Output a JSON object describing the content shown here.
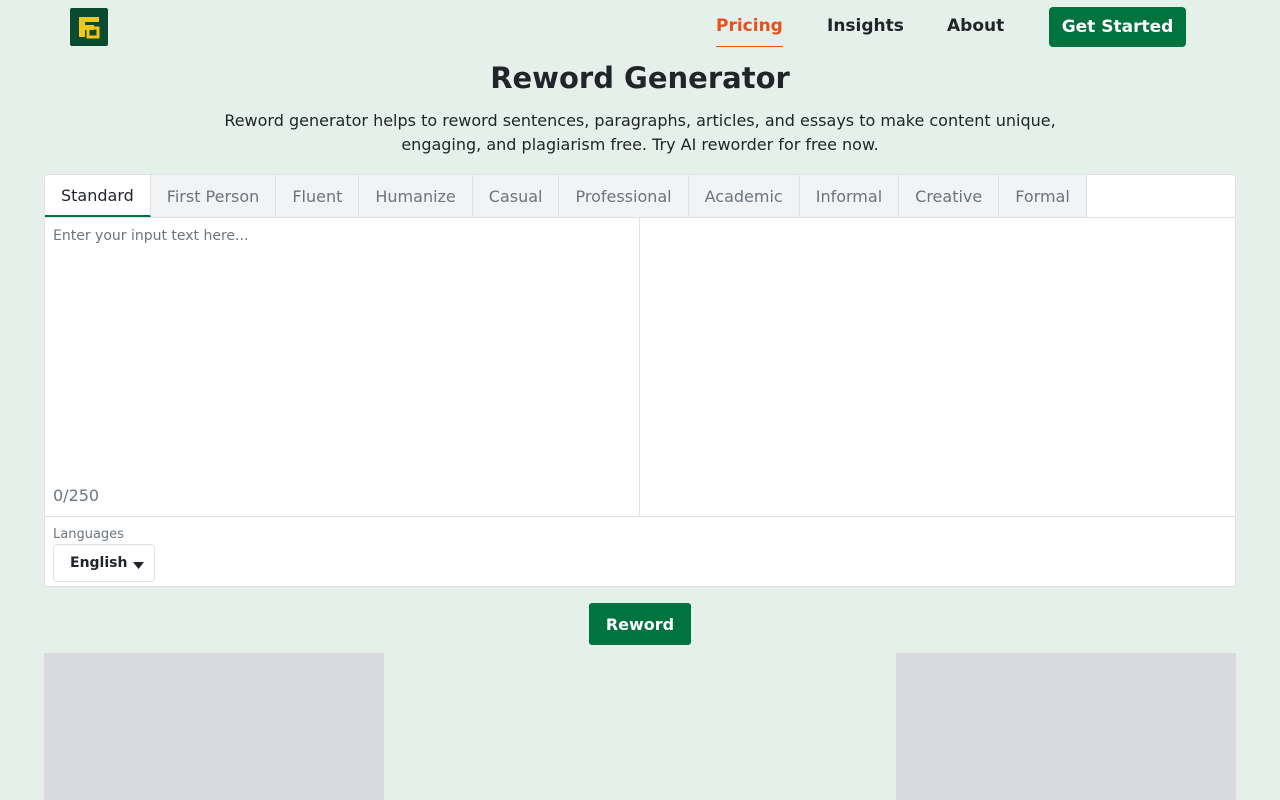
{
  "header": {
    "logo_icon": "brand-logo-icon",
    "nav": {
      "pricing": "Pricing",
      "insights": "Insights",
      "about": "About"
    },
    "cta": "Get Started"
  },
  "hero": {
    "title": "Reword Generator",
    "subtitle": "Reword generator helps to reword sentences, paragraphs, articles, and essays to make content unique, engaging, and plagiarism free. Try AI reworder for free now."
  },
  "editor": {
    "tabs": [
      "Standard",
      "First Person",
      "Fluent",
      "Humanize",
      "Casual",
      "Professional",
      "Academic",
      "Informal",
      "Creative",
      "Formal"
    ],
    "active_tab": "Standard",
    "input_placeholder": "Enter your input text here...",
    "input_value": "",
    "counter": "0/250",
    "languages_label": "Languages",
    "language_selected": "English",
    "language_caret_icon": "caret-down-icon"
  },
  "actions": {
    "reword": "Reword"
  },
  "colors": {
    "background": "#e6f0eb",
    "primary": "#00733e",
    "accent": "#e8501c",
    "logo_bg": "#0a4a2e",
    "logo_fg": "#f5c518"
  }
}
